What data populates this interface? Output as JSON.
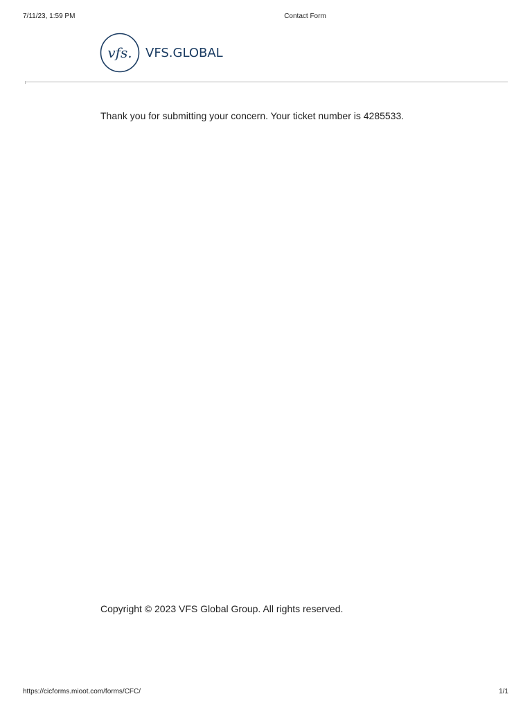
{
  "print_header": {
    "datetime": "7/11/23, 1:59 PM",
    "title": "Contact Form"
  },
  "logo": {
    "monogram": "vfs.",
    "wordmark": "VFS.GLOBAL",
    "color": "#1c3d63"
  },
  "main": {
    "confirmation_message": "Thank you for submitting your concern. Your ticket number is 4285533."
  },
  "footer": {
    "copyright": "Copyright © 2023 VFS Global Group. All rights reserved."
  },
  "print_footer": {
    "url": "https://cicforms.mioot.com/forms/CFC/",
    "page_indicator": "1/1"
  }
}
